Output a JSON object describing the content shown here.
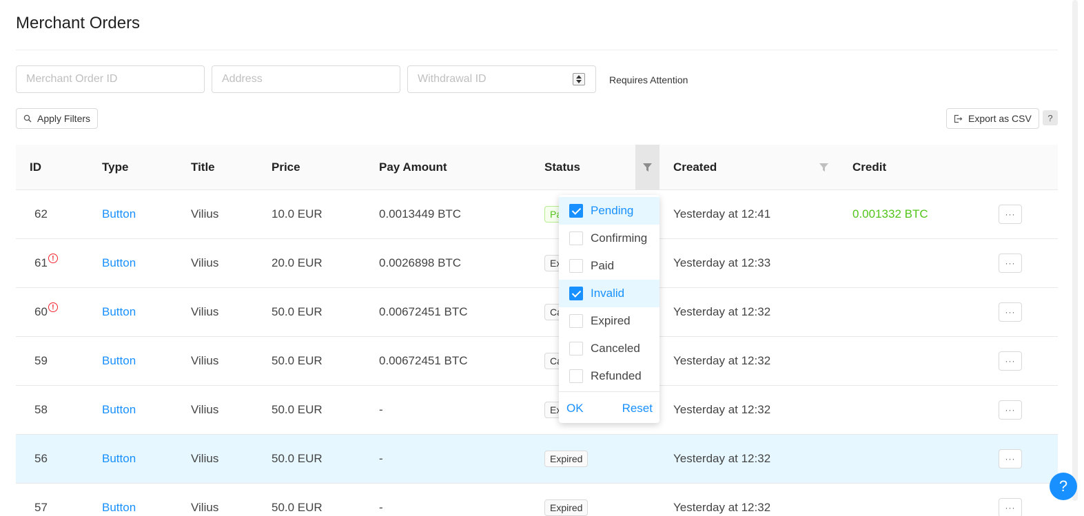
{
  "page": {
    "title": "Merchant Orders"
  },
  "filters": {
    "merchant_order_id_placeholder": "Merchant Order ID",
    "address_placeholder": "Address",
    "withdrawal_id_placeholder": "Withdrawal ID",
    "requires_attention_label": "Requires Attention"
  },
  "toolbar": {
    "apply_label": "Apply Filters",
    "export_label": "Export as CSV",
    "help_label": "?"
  },
  "columns": [
    "ID",
    "Type",
    "Title",
    "Price",
    "Pay Amount",
    "Status",
    "Created",
    "Credit"
  ],
  "rows": [
    {
      "id": "62",
      "alert": false,
      "type": "Button",
      "title": "Vilius",
      "price": "10.0 EUR",
      "pay": "0.0013449 BTC",
      "status": "Pa",
      "created": "Yesterday at 12:41",
      "credit": "0.001332 BTC"
    },
    {
      "id": "61",
      "alert": true,
      "type": "Button",
      "title": "Vilius",
      "price": "20.0 EUR",
      "pay": "0.0026898 BTC",
      "status": "Ex",
      "created": "Yesterday at 12:33",
      "credit": ""
    },
    {
      "id": "60",
      "alert": true,
      "type": "Button",
      "title": "Vilius",
      "price": "50.0 EUR",
      "pay": "0.00672451 BTC",
      "status": "Ca",
      "created": "Yesterday at 12:32",
      "credit": ""
    },
    {
      "id": "59",
      "alert": false,
      "type": "Button",
      "title": "Vilius",
      "price": "50.0 EUR",
      "pay": "0.00672451 BTC",
      "status": "Ca",
      "created": "Yesterday at 12:32",
      "credit": ""
    },
    {
      "id": "58",
      "alert": false,
      "type": "Button",
      "title": "Vilius",
      "price": "50.0 EUR",
      "pay": "-",
      "status": "Ex",
      "created": "Yesterday at 12:32",
      "credit": ""
    },
    {
      "id": "56",
      "alert": false,
      "type": "Button",
      "title": "Vilius",
      "price": "50.0 EUR",
      "pay": "-",
      "status": "Expired",
      "created": "Yesterday at 12:32",
      "credit": "",
      "selected": true
    },
    {
      "id": "57",
      "alert": false,
      "type": "Button",
      "title": "Vilius",
      "price": "50.0 EUR",
      "pay": "-",
      "status": "Expired",
      "created": "Yesterday at 12:32",
      "credit": ""
    }
  ],
  "row_action_label": "···",
  "status_filter": {
    "options": [
      {
        "label": "Pending",
        "checked": true
      },
      {
        "label": "Confirming",
        "checked": false
      },
      {
        "label": "Paid",
        "checked": false
      },
      {
        "label": "Invalid",
        "checked": true
      },
      {
        "label": "Expired",
        "checked": false
      },
      {
        "label": "Canceled",
        "checked": false
      },
      {
        "label": "Refunded",
        "checked": false
      }
    ],
    "ok_label": "OK",
    "reset_label": "Reset"
  },
  "help_fab_label": "?",
  "colors": {
    "accent": "#1890ff",
    "success": "#52c41a",
    "danger": "#f5222d",
    "selected_row": "#e6f7ff"
  },
  "icons": {
    "search": "search-icon",
    "export": "export-icon",
    "filter": "filter-icon",
    "alert": "alert-circle-icon"
  }
}
